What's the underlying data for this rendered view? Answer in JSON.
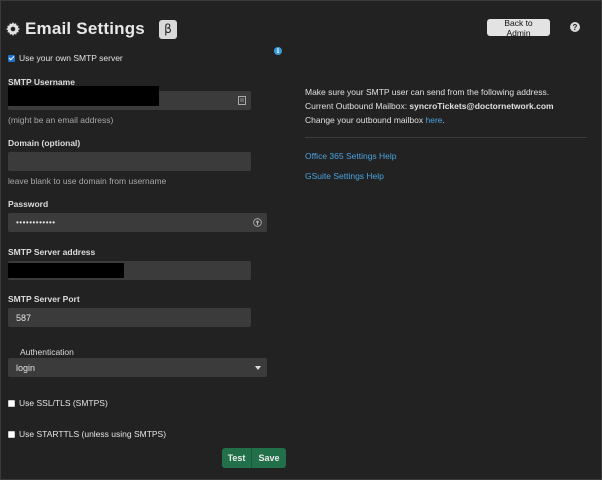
{
  "header": {
    "title": "Email Settings",
    "beta_badge": "β",
    "back_button": "Back to Admin",
    "help_icon": "?"
  },
  "form": {
    "use_own_smtp": {
      "label": "Use your own SMTP server",
      "checked": true
    },
    "smtp_username": {
      "label": "SMTP Username",
      "hint": "(might be an email address)"
    },
    "domain": {
      "label": "Domain (optional)",
      "value": "",
      "hint": "leave blank to use domain from username"
    },
    "password": {
      "label": "Password",
      "value": "••••••••••••"
    },
    "server_address": {
      "label": "SMTP Server address"
    },
    "server_port": {
      "label": "SMTP Server Port",
      "value": "587"
    },
    "authentication": {
      "label": "Authentication",
      "selected": "login"
    },
    "use_ssl": {
      "label": "Use SSL/TLS (SMTPS)",
      "checked": false
    },
    "use_starttls": {
      "label": "Use STARTTLS (unless using SMTPS)",
      "checked": false
    },
    "test_button": "Test",
    "save_button": "Save"
  },
  "info_panel": {
    "line1": "Make sure your SMTP user can send from the following address.",
    "line2_prefix": "Current Outbound Mailbox: ",
    "mailbox": "syncroTickets@doctornetwork.com",
    "line3_prefix": "Change your outbound mailbox ",
    "here_link": "here",
    "line3_suffix": ".",
    "links": [
      "Office 365 Settings Help",
      "GSuite Settings Help"
    ]
  },
  "colors": {
    "background": "#222222",
    "input_bg": "#3b3b3b",
    "link": "#4aa3df",
    "checkbox_on": "#1e74c8",
    "save_green": "#22704a"
  }
}
